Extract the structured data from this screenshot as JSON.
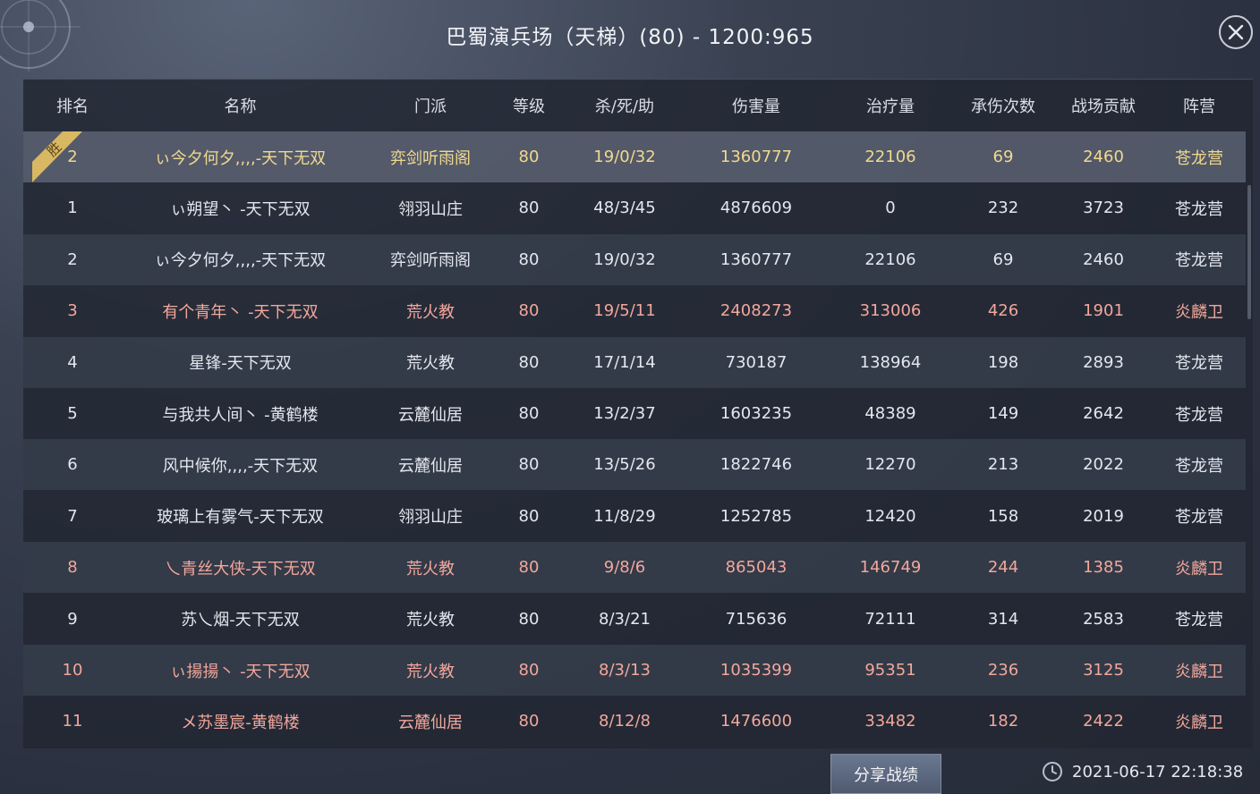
{
  "title": "巴蜀演兵场（天梯）(80) - 1200:965",
  "colors": {
    "faction_blue_text": "#e4e7ee",
    "faction_red_text": "#f2a79b",
    "highlight_text": "#f1d98f",
    "badge_gold": "#d9b863"
  },
  "header": [
    "排名",
    "名称",
    "门派",
    "等级",
    "杀/死/助",
    "伤害量",
    "治疗量",
    "承伤次数",
    "战场贡献",
    "阵营"
  ],
  "win_badge": "胜",
  "rows": [
    {
      "rank": "2",
      "name": "ぃ今夕何夕,,,,-天下无双",
      "school": "弈剑听雨阁",
      "level": "80",
      "kda": "19/0/32",
      "damage": "1360777",
      "heal": "22106",
      "hits": "69",
      "contrib": "2460",
      "faction": "苍龙营",
      "side": "highlight"
    },
    {
      "rank": "1",
      "name": "ぃ朔望丶 -天下无双",
      "school": "翎羽山庄",
      "level": "80",
      "kda": "48/3/45",
      "damage": "4876609",
      "heal": "0",
      "hits": "232",
      "contrib": "3723",
      "faction": "苍龙营",
      "side": "blue"
    },
    {
      "rank": "2",
      "name": "ぃ今夕何夕,,,,-天下无双",
      "school": "弈剑听雨阁",
      "level": "80",
      "kda": "19/0/32",
      "damage": "1360777",
      "heal": "22106",
      "hits": "69",
      "contrib": "2460",
      "faction": "苍龙营",
      "side": "blue"
    },
    {
      "rank": "3",
      "name": "有个青年丶 -天下无双",
      "school": "荒火教",
      "level": "80",
      "kda": "19/5/11",
      "damage": "2408273",
      "heal": "313006",
      "hits": "426",
      "contrib": "1901",
      "faction": "炎麟卫",
      "side": "red"
    },
    {
      "rank": "4",
      "name": "星锋-天下无双",
      "school": "荒火教",
      "level": "80",
      "kda": "17/1/14",
      "damage": "730187",
      "heal": "138964",
      "hits": "198",
      "contrib": "2893",
      "faction": "苍龙营",
      "side": "blue"
    },
    {
      "rank": "5",
      "name": "与我共人间丶 -黄鹤楼",
      "school": "云麓仙居",
      "level": "80",
      "kda": "13/2/37",
      "damage": "1603235",
      "heal": "48389",
      "hits": "149",
      "contrib": "2642",
      "faction": "苍龙营",
      "side": "blue"
    },
    {
      "rank": "6",
      "name": "风中候你,,,,-天下无双",
      "school": "云麓仙居",
      "level": "80",
      "kda": "13/5/26",
      "damage": "1822746",
      "heal": "12270",
      "hits": "213",
      "contrib": "2022",
      "faction": "苍龙营",
      "side": "blue"
    },
    {
      "rank": "7",
      "name": "玻璃上有雾气-天下无双",
      "school": "翎羽山庄",
      "level": "80",
      "kda": "11/8/29",
      "damage": "1252785",
      "heal": "12420",
      "hits": "158",
      "contrib": "2019",
      "faction": "苍龙营",
      "side": "blue"
    },
    {
      "rank": "8",
      "name": "乀青丝大侠-天下无双",
      "school": "荒火教",
      "level": "80",
      "kda": "9/8/6",
      "damage": "865043",
      "heal": "146749",
      "hits": "244",
      "contrib": "1385",
      "faction": "炎麟卫",
      "side": "red"
    },
    {
      "rank": "9",
      "name": "苏乀烟-天下无双",
      "school": "荒火教",
      "level": "80",
      "kda": "8/3/21",
      "damage": "715636",
      "heal": "72111",
      "hits": "314",
      "contrib": "2583",
      "faction": "苍龙营",
      "side": "blue"
    },
    {
      "rank": "10",
      "name": "ぃ揚揚丶 -天下无双",
      "school": "荒火教",
      "level": "80",
      "kda": "8/3/13",
      "damage": "1035399",
      "heal": "95351",
      "hits": "236",
      "contrib": "3125",
      "faction": "炎麟卫",
      "side": "red"
    },
    {
      "rank": "11",
      "name": "メ苏墨宸-黄鹤楼",
      "school": "云麓仙居",
      "level": "80",
      "kda": "8/12/8",
      "damage": "1476600",
      "heal": "33482",
      "hits": "182",
      "contrib": "2422",
      "faction": "炎麟卫",
      "side": "red"
    }
  ],
  "share_label": "分享战绩",
  "timestamp": "2021-06-17 22:18:38",
  "icons": {
    "close": "close-icon",
    "clock": "clock-icon"
  }
}
